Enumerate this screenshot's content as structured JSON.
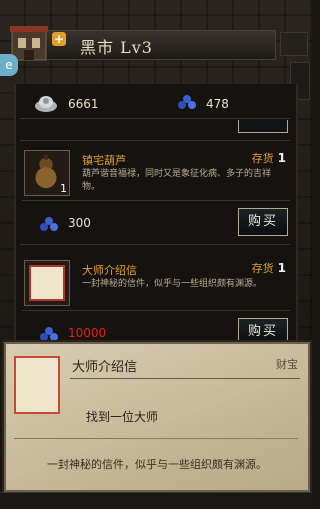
{
  "header": {
    "title": "黑市  Lv3"
  },
  "side_tab_label": "e",
  "currency": {
    "silver": "6661",
    "gems": "478"
  },
  "items": [
    {
      "name": "镇宅葫芦",
      "stock_label": "存货",
      "stock": "1",
      "thumb_count": "1",
      "desc": "葫芦谐音福禄，同时又是象征化病、多子的吉祥物。",
      "price": "300",
      "price_color": "#e8e0d0",
      "buy_label": "购买"
    },
    {
      "name": "大师介绍信",
      "stock_label": "存货",
      "stock": "1",
      "desc": "一封神秘的信件，似乎与一些组织颇有渊源。",
      "price": "10000",
      "price_color": "#e0201a",
      "buy_label": "购买"
    }
  ],
  "tooltip": {
    "name": "大师介绍信",
    "type": "财宝",
    "usage": "找到一位大师",
    "desc": "一封神秘的信件，似乎与一些组织颇有渊源。"
  },
  "colors": {
    "accent": "#e2a32c",
    "gem": "#3a5fd0"
  },
  "icons": [
    "shop-building-icon",
    "plus-icon",
    "silver-ingot-icon",
    "gem-icon",
    "gourd-icon",
    "letter-icon"
  ]
}
